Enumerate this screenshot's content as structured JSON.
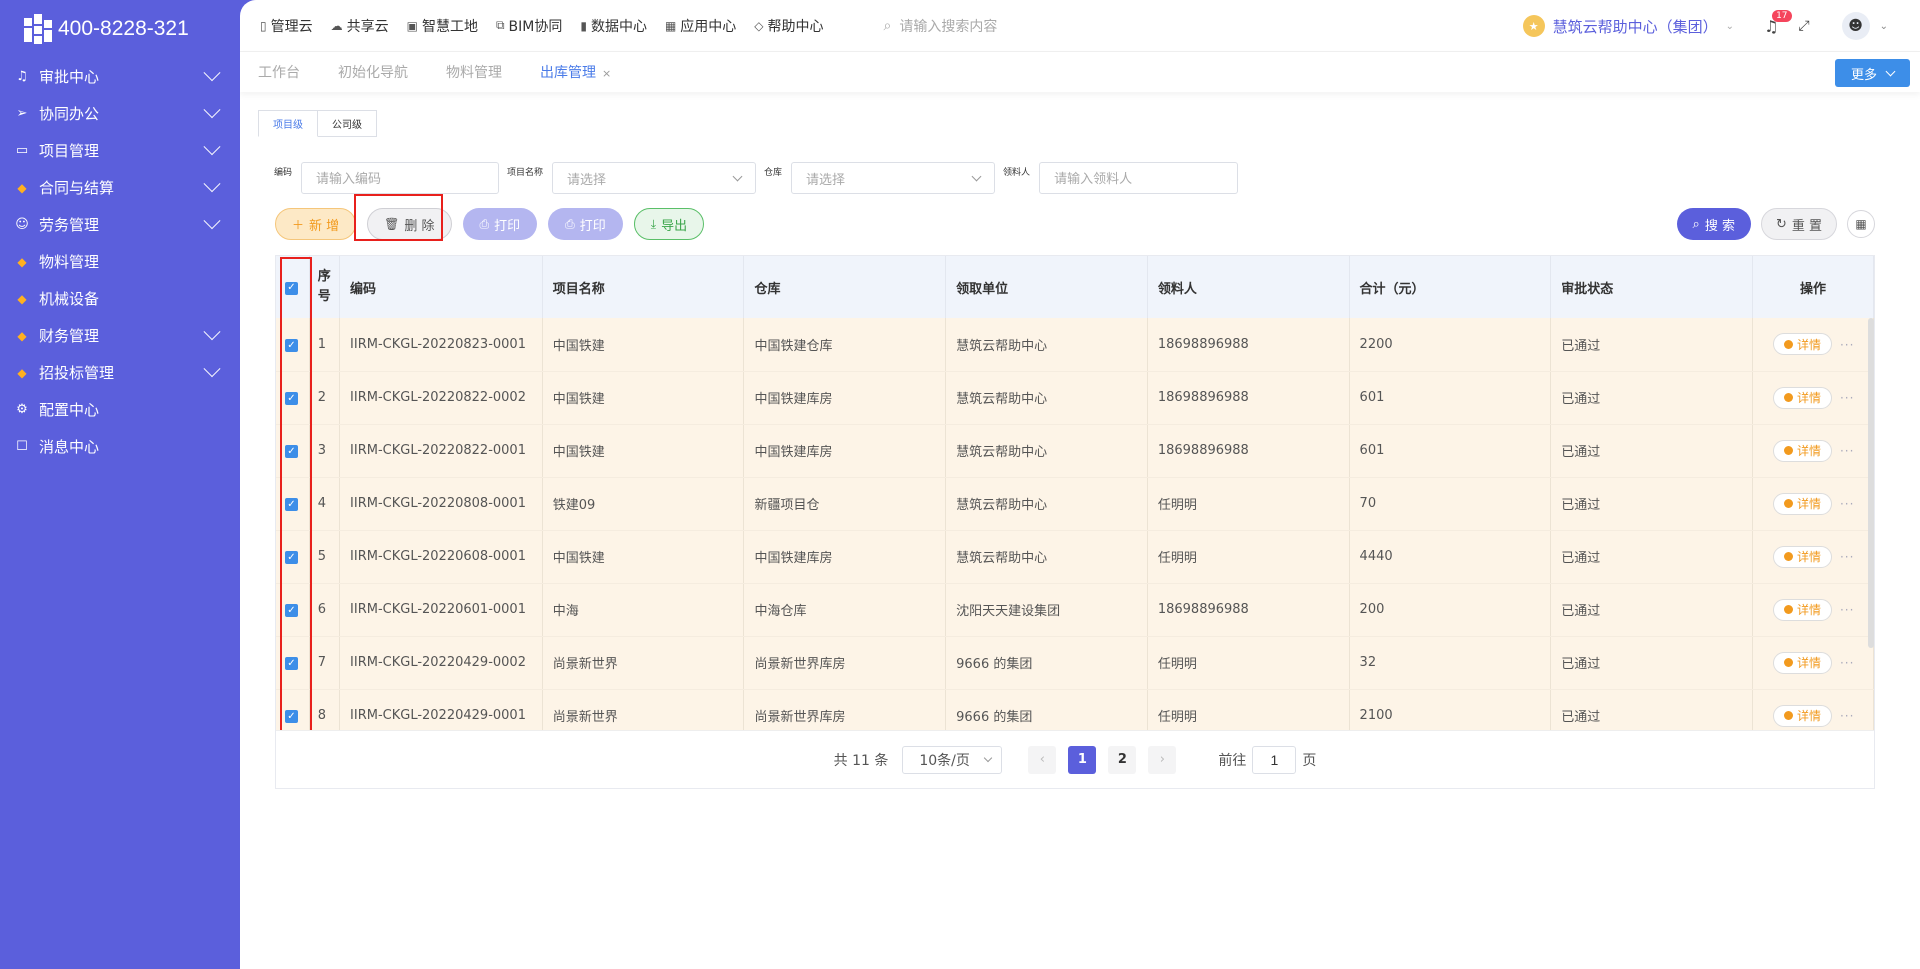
{
  "brand": {
    "phone": "400-8228-321"
  },
  "sidebar": {
    "items": [
      {
        "label": "审批中心",
        "icon": "bell-icon",
        "glyph": "♫",
        "expandable": true
      },
      {
        "label": "协同办公",
        "icon": "send-icon",
        "glyph": "➢",
        "expandable": true
      },
      {
        "label": "项目管理",
        "icon": "book-icon",
        "glyph": "▭",
        "expandable": true
      },
      {
        "label": "合同与结算",
        "icon": "diamond-icon",
        "glyph": "◆",
        "expandable": true
      },
      {
        "label": "劳务管理",
        "icon": "user-icon",
        "glyph": "☺",
        "expandable": true
      },
      {
        "label": "物料管理",
        "icon": "diamond-icon",
        "glyph": "◆",
        "expandable": false
      },
      {
        "label": "机械设备",
        "icon": "diamond-icon",
        "glyph": "◆",
        "expandable": false
      },
      {
        "label": "财务管理",
        "icon": "diamond-icon",
        "glyph": "◆",
        "expandable": true
      },
      {
        "label": "招投标管理",
        "icon": "diamond-icon",
        "glyph": "◆",
        "expandable": true
      },
      {
        "label": "配置中心",
        "icon": "gear-icon",
        "glyph": "⚙",
        "expandable": false
      },
      {
        "label": "消息中心",
        "icon": "message-icon",
        "glyph": "☐",
        "expandable": false
      }
    ]
  },
  "topnav": {
    "items": [
      {
        "label": "管理云",
        "icon": "document-icon"
      },
      {
        "label": "共享云",
        "icon": "cloud-icon"
      },
      {
        "label": "智慧工地",
        "icon": "site-icon"
      },
      {
        "label": "BIM协同",
        "icon": "bim-icon"
      },
      {
        "label": "数据中心",
        "icon": "bar-chart-icon"
      },
      {
        "label": "应用中心",
        "icon": "grid-icon"
      },
      {
        "label": "帮助中心",
        "icon": "help-icon"
      }
    ],
    "search_placeholder": "请输入搜索内容",
    "org_name": "慧筑云帮助中心（集团）",
    "notification_count": "17"
  },
  "tabs": {
    "items": [
      "工作台",
      "初始化导航",
      "物料管理",
      "出库管理"
    ],
    "active_index": 3,
    "more_label": "更多"
  },
  "level_tabs": [
    "项目级",
    "公司级"
  ],
  "filters": {
    "code_label": "编码",
    "code_placeholder": "请输入编码",
    "project_label": "项目名称",
    "project_placeholder": "请选择",
    "warehouse_label": "仓库",
    "warehouse_placeholder": "请选择",
    "receiver_label": "领料人",
    "receiver_placeholder": "请输入领料人"
  },
  "toolbar": {
    "add_label": "新 增",
    "delete_label": "删 除",
    "print1_label": "打印",
    "print2_label": "打印",
    "export_label": "导出",
    "search_label": "搜 索",
    "reset_label": "重 置"
  },
  "table": {
    "headers": [
      "序号",
      "编码",
      "项目名称",
      "仓库",
      "领取单位",
      "领料人",
      "合计（元）",
      "审批状态",
      "操作"
    ],
    "detail_label": "详情",
    "rows": [
      {
        "no": "1",
        "code": "IIRM-CKGL-20220823-0001",
        "project": "中国铁建",
        "warehouse": "中国铁建仓库",
        "unit": "慧筑云帮助中心",
        "receiver": "18698896988",
        "total": "2200",
        "status": "已通过"
      },
      {
        "no": "2",
        "code": "IIRM-CKGL-20220822-0002",
        "project": "中国铁建",
        "warehouse": "中国铁建库房",
        "unit": "慧筑云帮助中心",
        "receiver": "18698896988",
        "total": "601",
        "status": "已通过"
      },
      {
        "no": "3",
        "code": "IIRM-CKGL-20220822-0001",
        "project": "中国铁建",
        "warehouse": "中国铁建库房",
        "unit": "慧筑云帮助中心",
        "receiver": "18698896988",
        "total": "601",
        "status": "已通过"
      },
      {
        "no": "4",
        "code": "IIRM-CKGL-20220808-0001",
        "project": "铁建09",
        "warehouse": "新疆项目仓",
        "unit": "慧筑云帮助中心",
        "receiver": "任明明",
        "total": "70",
        "status": "已通过"
      },
      {
        "no": "5",
        "code": "IIRM-CKGL-20220608-0001",
        "project": "中国铁建",
        "warehouse": "中国铁建库房",
        "unit": "慧筑云帮助中心",
        "receiver": "任明明",
        "total": "4440",
        "status": "已通过"
      },
      {
        "no": "6",
        "code": "IIRM-CKGL-20220601-0001",
        "project": "中海",
        "warehouse": "中海仓库",
        "unit": "沈阳天天建设集团",
        "receiver": "18698896988",
        "total": "200",
        "status": "已通过"
      },
      {
        "no": "7",
        "code": "IIRM-CKGL-20220429-0002",
        "project": "尚景新世界",
        "warehouse": "尚景新世界库房",
        "unit": "9666 的集团",
        "receiver": "任明明",
        "total": "32",
        "status": "已通过"
      },
      {
        "no": "8",
        "code": "IIRM-CKGL-20220429-0001",
        "project": "尚景新世界",
        "warehouse": "尚景新世界库房",
        "unit": "9666 的集团",
        "receiver": "任明明",
        "total": "2100",
        "status": "已通过"
      }
    ]
  },
  "pagination": {
    "total_text": "共 11 条",
    "page_size": "10条/页",
    "pages": [
      "1",
      "2"
    ],
    "current": "1",
    "goto_prefix": "前往",
    "goto_value": "1",
    "goto_suffix": "页"
  }
}
